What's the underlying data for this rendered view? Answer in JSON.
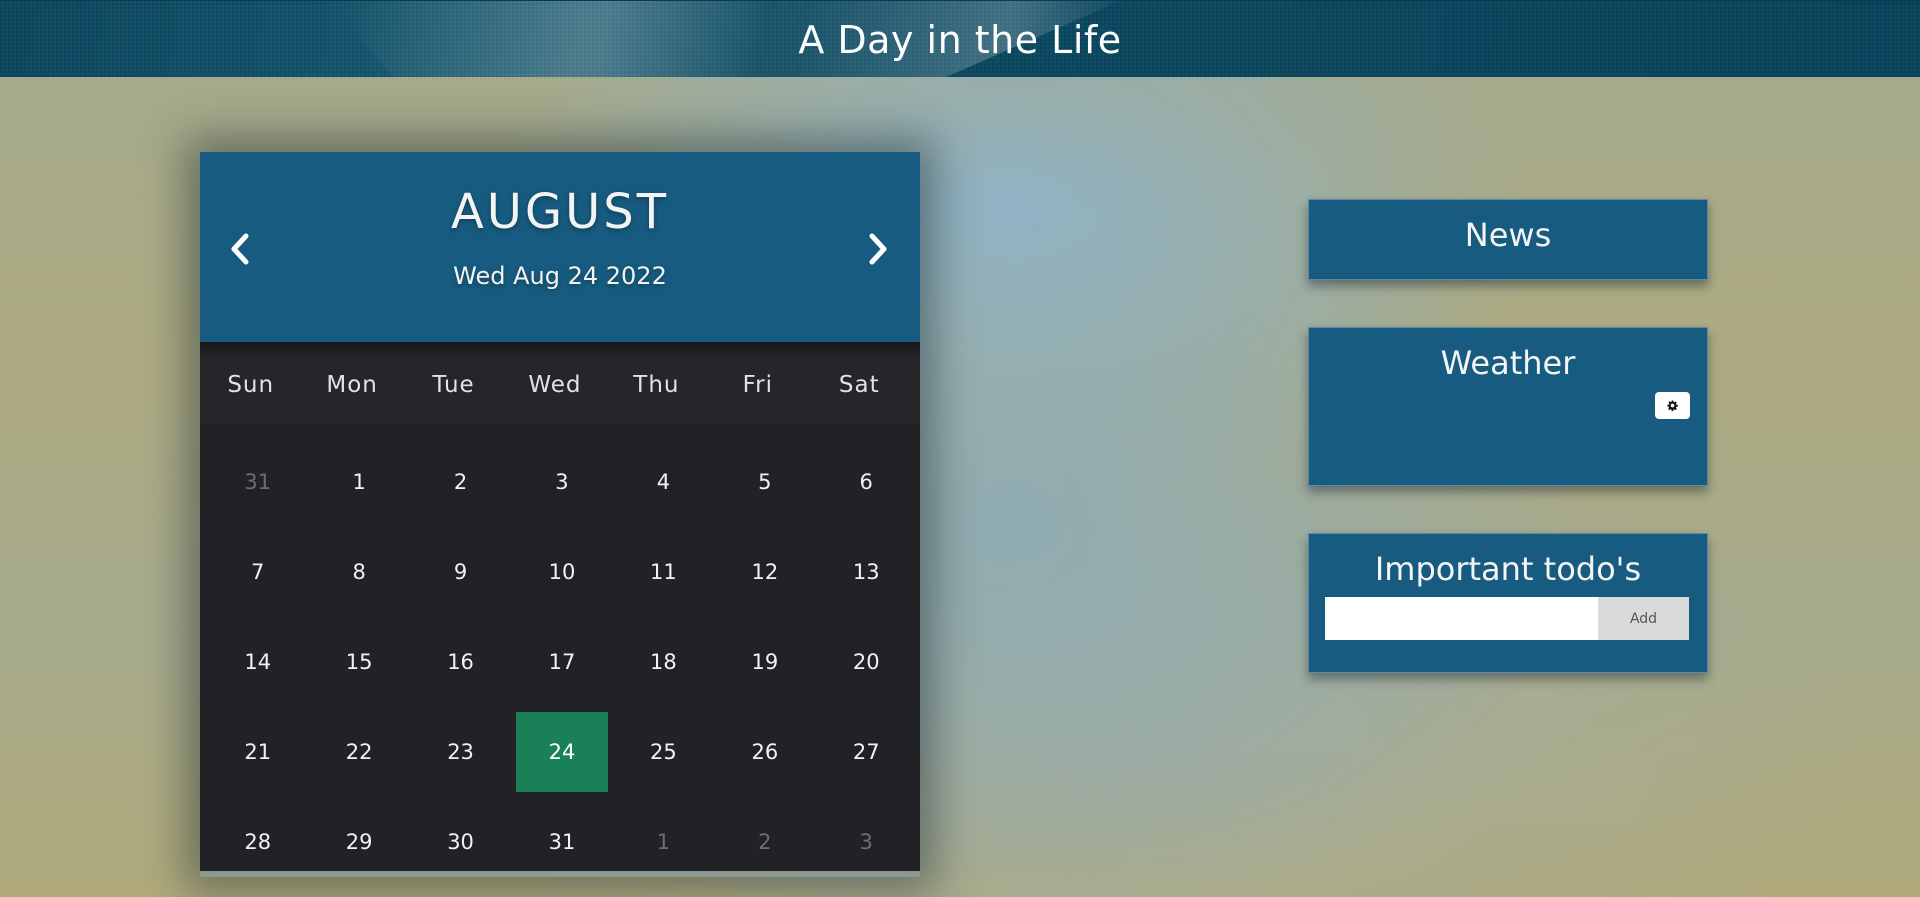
{
  "header": {
    "title": "A Day in the Life"
  },
  "calendar": {
    "month": "AUGUST",
    "current_date": "Wed Aug 24 2022",
    "prev_icon": "chevron-left-icon",
    "next_icon": "chevron-right-icon",
    "weekdays": [
      "Sun",
      "Mon",
      "Tue",
      "Wed",
      "Thu",
      "Fri",
      "Sat"
    ],
    "weeks": [
      [
        {
          "d": "31",
          "muted": true
        },
        {
          "d": "1"
        },
        {
          "d": "2"
        },
        {
          "d": "3"
        },
        {
          "d": "4"
        },
        {
          "d": "5"
        },
        {
          "d": "6"
        }
      ],
      [
        {
          "d": "7"
        },
        {
          "d": "8"
        },
        {
          "d": "9"
        },
        {
          "d": "10"
        },
        {
          "d": "11"
        },
        {
          "d": "12"
        },
        {
          "d": "13"
        }
      ],
      [
        {
          "d": "14"
        },
        {
          "d": "15"
        },
        {
          "d": "16"
        },
        {
          "d": "17"
        },
        {
          "d": "18"
        },
        {
          "d": "19"
        },
        {
          "d": "20"
        }
      ],
      [
        {
          "d": "21"
        },
        {
          "d": "22"
        },
        {
          "d": "23"
        },
        {
          "d": "24",
          "today": true
        },
        {
          "d": "25"
        },
        {
          "d": "26"
        },
        {
          "d": "27"
        }
      ],
      [
        {
          "d": "28"
        },
        {
          "d": "29"
        },
        {
          "d": "30"
        },
        {
          "d": "31"
        },
        {
          "d": "1",
          "muted": true
        },
        {
          "d": "2",
          "muted": true
        },
        {
          "d": "3",
          "muted": true
        }
      ]
    ],
    "today_color": "#198058",
    "header_color": "#175c80"
  },
  "widgets": {
    "news": {
      "title": "News"
    },
    "weather": {
      "title": "Weather",
      "settings_icon": "gear-icon"
    },
    "todos": {
      "title": "Important todo's",
      "input_value": "",
      "add_label": "Add"
    }
  },
  "colors": {
    "accent": "#175c80",
    "topbar": "#0f4d66"
  }
}
